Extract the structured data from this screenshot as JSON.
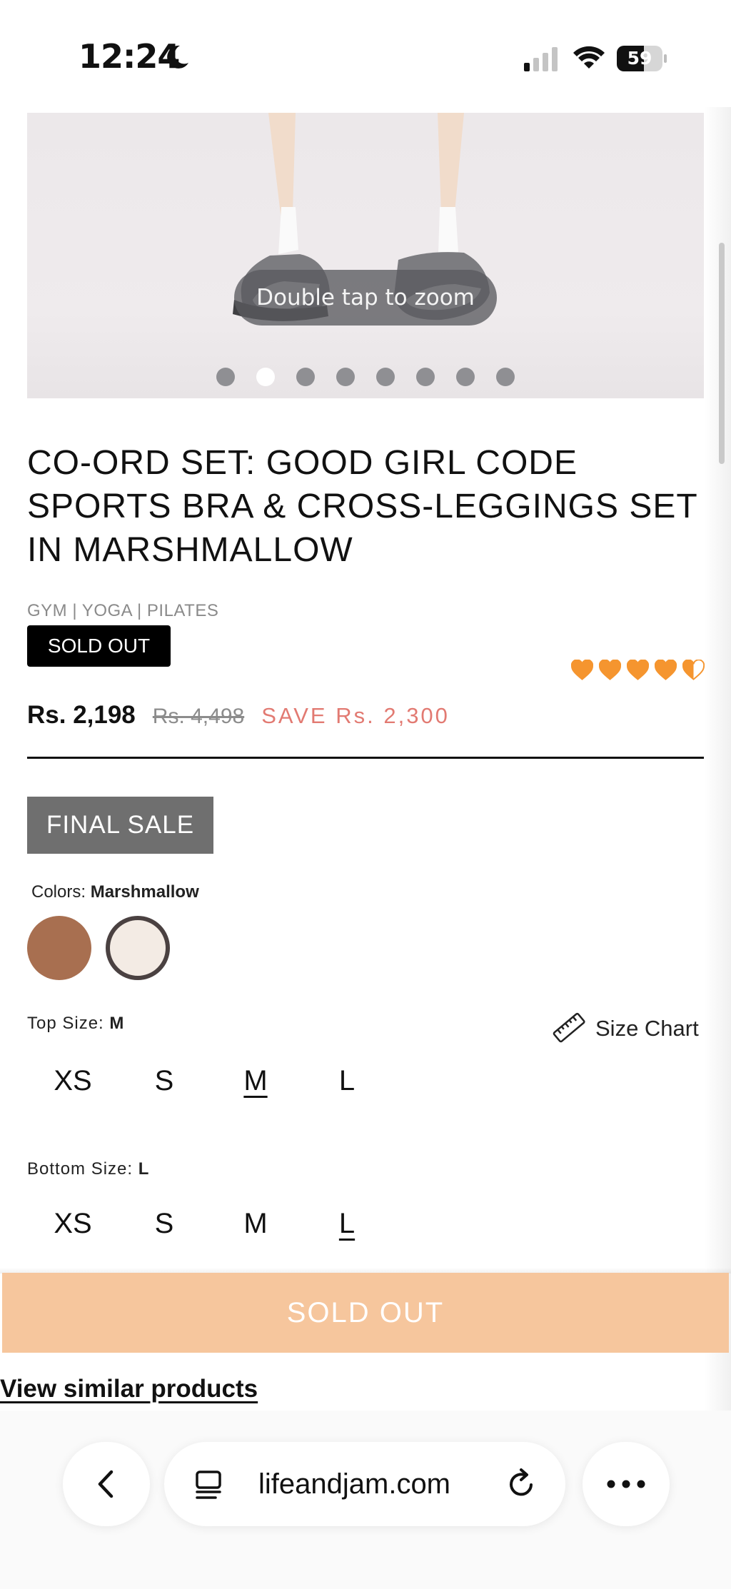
{
  "status_bar": {
    "time": "12:24",
    "battery": "59",
    "battery_level": 0.59,
    "icons": [
      "moon-icon",
      "signal-icon",
      "wifi-icon",
      "battery-icon"
    ]
  },
  "gallery": {
    "zoom_hint": "Double tap to zoom",
    "dot_count": 8,
    "active_dot": 2
  },
  "product": {
    "title": "CO-ORD SET: GOOD GIRL CODE SPORTS BRA & CROSS-LEGGINGS SET IN MARSHMALLOW",
    "category": "GYM | YOGA | PILATES",
    "badge": "SOLD OUT",
    "rating": 4.5,
    "rating_max": 5,
    "rating_color": "#f5952f",
    "price": "Rs. 2,198",
    "compare_price": "Rs. 4,498",
    "save_text": "SAVE Rs. 2,300",
    "final_sale_label": "FINAL SALE"
  },
  "colors": {
    "label": "Colors:",
    "selected": "Marshmallow",
    "swatches": [
      {
        "name": "Brown",
        "hex": "#a86f50"
      },
      {
        "name": "Marshmallow",
        "hex": "#f3ebe4",
        "selected": true
      }
    ]
  },
  "top_size": {
    "label": "Top Size:",
    "selected": "M",
    "options": [
      "XS",
      "S",
      "M",
      "L"
    ]
  },
  "size_chart": {
    "label": "Size Chart"
  },
  "bottom_size": {
    "label": "Bottom Size:",
    "selected": "L",
    "options": [
      "XS",
      "S",
      "M",
      "L"
    ]
  },
  "actions": {
    "sold_out_button": "SOLD OUT",
    "view_similar": "View similar products"
  },
  "browser": {
    "url": "lifeandjam.com"
  }
}
